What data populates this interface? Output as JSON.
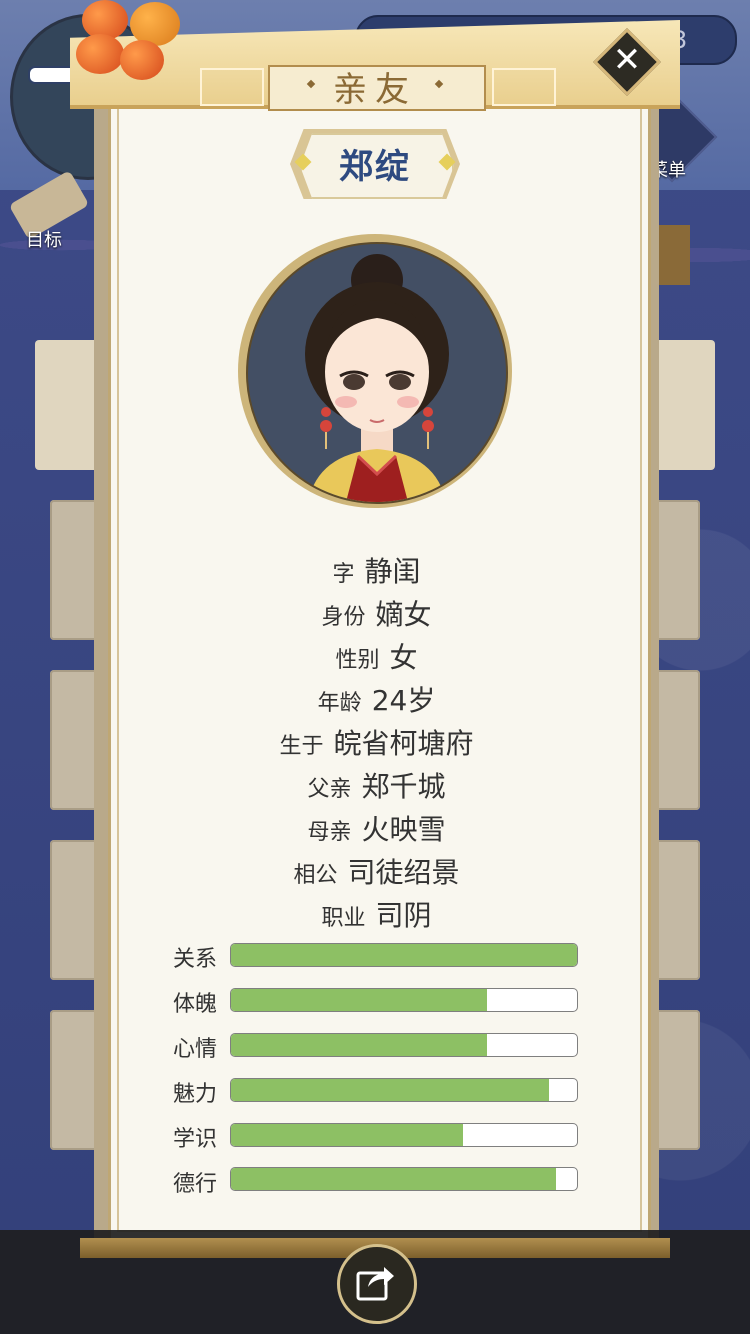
{
  "background": {
    "goal_label": "目标",
    "menu_label": "菜单",
    "top_number": "3"
  },
  "dialog": {
    "title": "亲友",
    "name": "郑绽",
    "info": [
      {
        "label": "字",
        "value": "静闺"
      },
      {
        "label": "身份",
        "value": "嫡女"
      },
      {
        "label": "性别",
        "value": "女"
      },
      {
        "label": "年龄",
        "value": "24岁"
      },
      {
        "label": "生于",
        "value": "皖省柯塘府"
      },
      {
        "label": "父亲",
        "value": "郑千城"
      },
      {
        "label": "母亲",
        "value": "火映雪"
      },
      {
        "label": "相公",
        "value": "司徒绍景"
      },
      {
        "label": "职业",
        "value": "司阴"
      }
    ],
    "stats": [
      {
        "label": "关系",
        "percent": 100
      },
      {
        "label": "体魄",
        "percent": 74
      },
      {
        "label": "心情",
        "percent": 74
      },
      {
        "label": "魅力",
        "percent": 92
      },
      {
        "label": "学识",
        "percent": 67
      },
      {
        "label": "德行",
        "percent": 94
      }
    ]
  },
  "colors": {
    "stat_fill": "#8dc064",
    "name_text": "#2e4a80",
    "title_text": "#8b6a35"
  },
  "icons": {
    "close": "close-icon",
    "share": "share-icon"
  }
}
